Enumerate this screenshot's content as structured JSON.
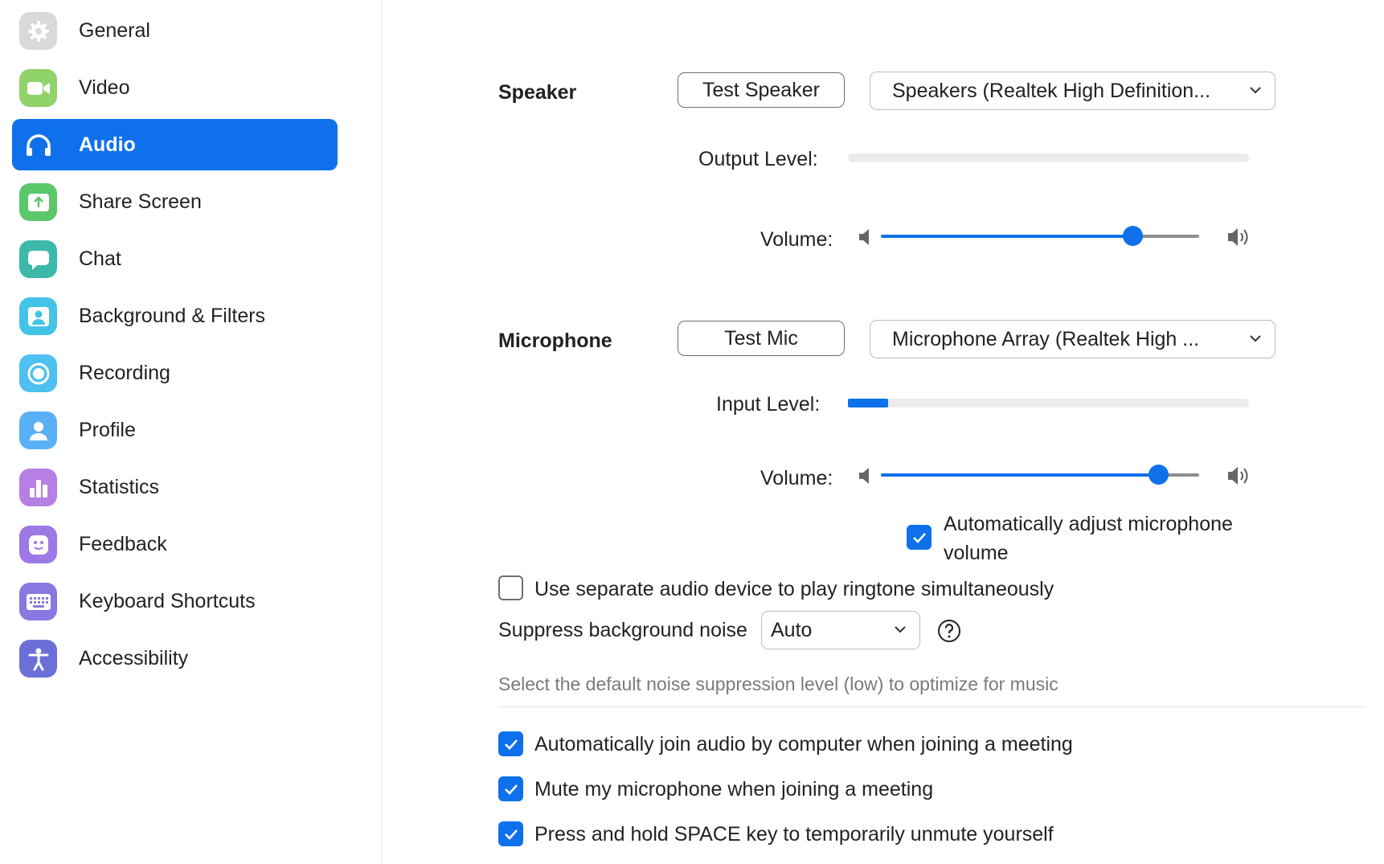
{
  "sidebar": {
    "items": [
      {
        "label": "General",
        "icon": "gear-icon",
        "color": "#d9d9d9",
        "active": false
      },
      {
        "label": "Video",
        "icon": "video-camera-icon",
        "color": "#8fd36a",
        "active": false
      },
      {
        "label": "Audio",
        "icon": "headphones-icon",
        "color": "#0e71eb",
        "active": true
      },
      {
        "label": "Share Screen",
        "icon": "share-screen-icon",
        "color": "#5cc66a",
        "active": false
      },
      {
        "label": "Chat",
        "icon": "chat-bubble-icon",
        "color": "#3cb9a8",
        "active": false
      },
      {
        "label": "Background & Filters",
        "icon": "background-person-icon",
        "color": "#43c4e6",
        "active": false
      },
      {
        "label": "Recording",
        "icon": "record-icon",
        "color": "#4ec0f2",
        "active": false
      },
      {
        "label": "Profile",
        "icon": "profile-person-icon",
        "color": "#5ab0f7",
        "active": false
      },
      {
        "label": "Statistics",
        "icon": "bar-chart-icon",
        "color": "#b77ee3",
        "active": false
      },
      {
        "label": "Feedback",
        "icon": "smiley-face-icon",
        "color": "#9e78e6",
        "active": false
      },
      {
        "label": "Keyboard Shortcuts",
        "icon": "keyboard-icon",
        "color": "#8a78e0",
        "active": false
      },
      {
        "label": "Accessibility",
        "icon": "accessibility-icon",
        "color": "#6b6fd8",
        "active": false
      }
    ]
  },
  "speaker": {
    "title": "Speaker",
    "test_button": "Test Speaker",
    "device": "Speakers (Realtek High Definition...",
    "output_level_label": "Output Level:",
    "output_level": 0.0,
    "volume_label": "Volume:",
    "volume": 0.79
  },
  "microphone": {
    "title": "Microphone",
    "test_button": "Test Mic",
    "device": "Microphone Array (Realtek High ...",
    "input_level_label": "Input Level:",
    "input_level": 0.1,
    "volume_label": "Volume:",
    "volume": 0.87,
    "auto_adjust_line1": "Automatically adjust microphone",
    "auto_adjust_line2": "volume",
    "auto_adjust_checked": true
  },
  "ringtone": {
    "label": "Use separate audio device to play ringtone simultaneously",
    "checked": false
  },
  "noise": {
    "label": "Suppress background noise",
    "value": "Auto",
    "help_icon": "question-circle-icon",
    "hint": "Select the default noise suppression level (low) to optimize for music"
  },
  "options": [
    {
      "label": "Automatically join audio by computer when joining a meeting",
      "checked": true
    },
    {
      "label": "Mute my microphone when joining a meeting",
      "checked": true
    },
    {
      "label": "Press and hold SPACE key to temporarily unmute yourself",
      "checked": true
    }
  ],
  "colors": {
    "accent": "#0e71eb"
  }
}
